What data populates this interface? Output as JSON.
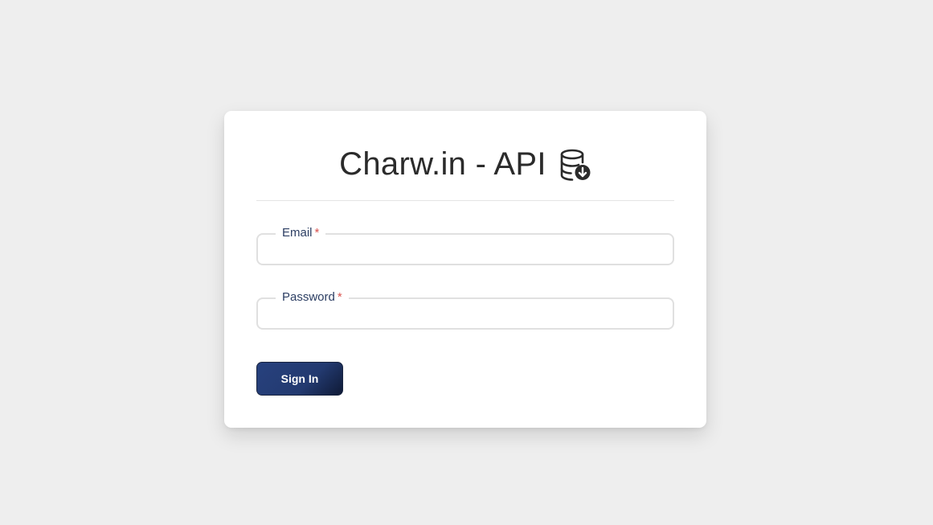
{
  "login": {
    "title": "Charw.in - API",
    "title_icon": "database-download-icon",
    "email": {
      "label": "Email",
      "required_marker": "*",
      "value": "",
      "placeholder": ""
    },
    "password": {
      "label": "Password",
      "required_marker": "*",
      "value": "",
      "placeholder": ""
    },
    "submit_label": "Sign In"
  },
  "colors": {
    "background": "#eeeeee",
    "card": "#ffffff",
    "button": "#233a70",
    "label": "#2c3e63",
    "required": "#d9534f",
    "field_border": "#e0e0e0"
  }
}
